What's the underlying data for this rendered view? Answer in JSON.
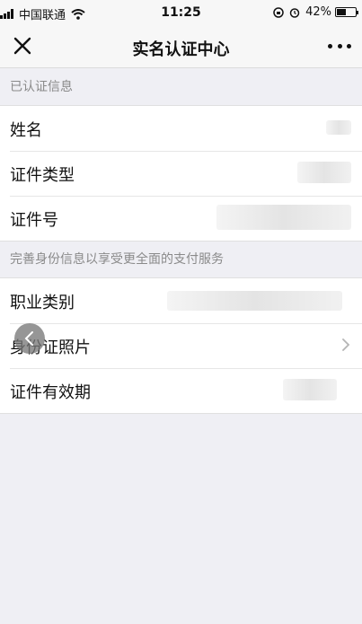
{
  "status_bar": {
    "carrier": "中国联通",
    "time": "11:25",
    "battery_percent": "42%",
    "battery_level": 0.42
  },
  "nav": {
    "title": "实名认证中心"
  },
  "sections": [
    {
      "header": "已认证信息",
      "rows": [
        {
          "label": "姓名"
        },
        {
          "label": "证件类型"
        },
        {
          "label": "证件号"
        }
      ]
    },
    {
      "header": "完善身份信息以享受更全面的支付服务",
      "rows": [
        {
          "label": "职业类别"
        },
        {
          "label": "身份证照片"
        },
        {
          "label": "证件有效期"
        }
      ]
    }
  ],
  "icons": [
    "close-icon",
    "more-icon",
    "chevron-right-icon",
    "back-icon",
    "wifi-icon",
    "alarm-icon"
  ]
}
